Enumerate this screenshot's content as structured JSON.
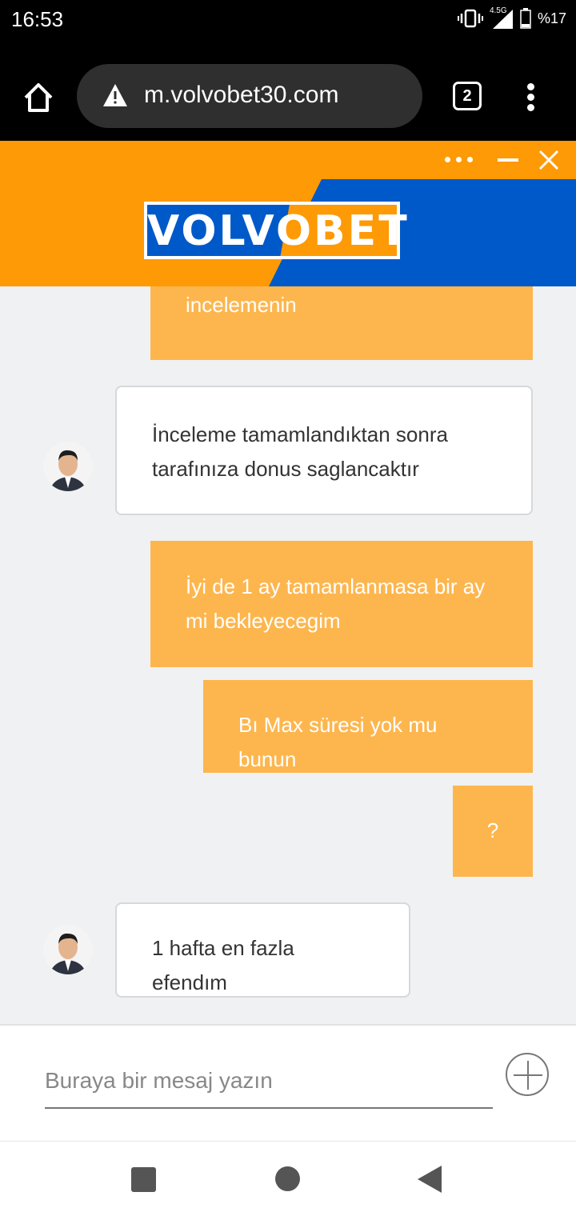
{
  "status_bar": {
    "time": "16:53",
    "network": "4.5G",
    "battery": "%17"
  },
  "browser": {
    "url": "m.volvobet30.com",
    "tab_count": "2"
  },
  "chat_header": {
    "logo": "VOLVOBET",
    "brand_colors": {
      "orange": "#fe9a05",
      "blue": "#0059c9"
    }
  },
  "messages": [
    {
      "from": "user",
      "text": "incelemenin"
    },
    {
      "from": "agent",
      "text": "İnceleme tamamlandıktan sonra tarafınıza donus saglancaktır"
    },
    {
      "from": "user",
      "text": "İyi de 1 ay tamamlanmasa bir ay mi bekleyecegim"
    },
    {
      "from": "user",
      "text": "Bı Max süresi yok mu bunun"
    },
    {
      "from": "user",
      "text": "?"
    },
    {
      "from": "agent",
      "text": "1 hafta en fazla efendım"
    }
  ],
  "composer": {
    "placeholder": "Buraya bir mesaj yazın"
  },
  "icons": [
    "home-icon",
    "warning-icon",
    "tabs-icon",
    "overflow-menu-icon",
    "more-icon",
    "minimize-icon",
    "close-icon",
    "plus-icon",
    "recents-icon",
    "home-nav-icon",
    "back-icon"
  ]
}
